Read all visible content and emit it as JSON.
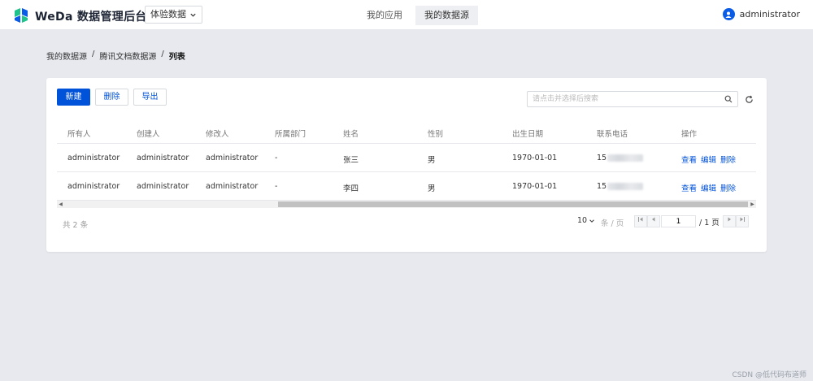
{
  "header": {
    "brand": "WeDa 数据管理后台",
    "env_select": "体验数据",
    "nav_tabs": [
      {
        "label": "我的应用",
        "active": false
      },
      {
        "label": "我的数据源",
        "active": true
      }
    ],
    "user_name": "administrator"
  },
  "breadcrumb": {
    "items": [
      "我的数据源",
      "腾讯文档数据源",
      "列表"
    ],
    "separator": "/"
  },
  "toolbar": {
    "new_label": "新建",
    "delete_label": "删除",
    "export_label": "导出",
    "search_placeholder": "请点击并选择后搜索"
  },
  "table": {
    "columns": [
      "所有人",
      "创建人",
      "修改人",
      "所属部门",
      "姓名",
      "性别",
      "出生日期",
      "联系电话",
      "操作"
    ],
    "rows": [
      {
        "owner": "administrator",
        "creator": "administrator",
        "modifier": "administrator",
        "dept": "-",
        "name": "张三",
        "gender": "男",
        "birth": "1970-01-01",
        "phone_prefix": "15"
      },
      {
        "owner": "administrator",
        "creator": "administrator",
        "modifier": "administrator",
        "dept": "-",
        "name": "李四",
        "gender": "男",
        "birth": "1970-01-01",
        "phone_prefix": "15"
      }
    ],
    "actions": {
      "view": "查看",
      "edit": "编辑",
      "delete": "删除"
    }
  },
  "pagination": {
    "total_text": "共 2 条",
    "page_size": "10",
    "per_page_label": "条 / 页",
    "current_page": "1",
    "total_pages_text": "/ 1 页"
  },
  "watermark": "CSDN @低代码布道师",
  "colors": {
    "primary": "#0052d9",
    "background": "#e7e9ee"
  }
}
